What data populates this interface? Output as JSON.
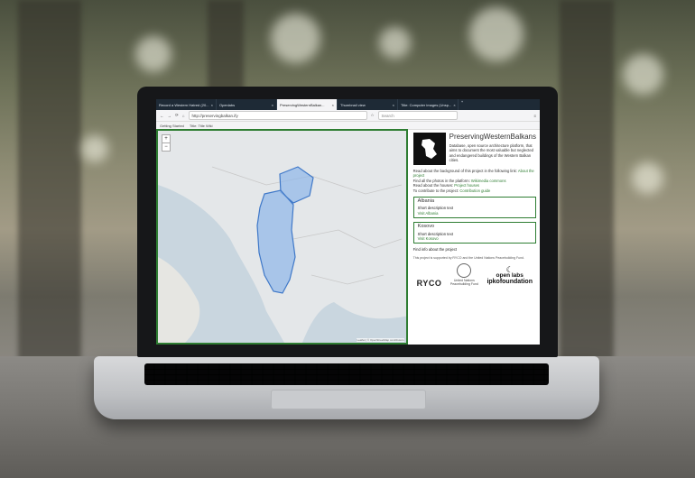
{
  "browser": {
    "tabs": [
      {
        "label": "Record a Western Hatred (20..."
      },
      {
        "label": "Openlabs"
      },
      {
        "label": "PreservingWesternBalkan..."
      },
      {
        "label": "Thumbnail view"
      },
      {
        "label": "Title: Computer images (Unsp..."
      }
    ],
    "url": "http://preservingbalkan.ify",
    "search_placeholder": "Search",
    "bookmarks": [
      "Getting Started",
      "Title: Title Wiki"
    ]
  },
  "map": {
    "zoom_in": "+",
    "zoom_out": "−",
    "attribution": "Leaflet | © OpenStreetMap contributors"
  },
  "panel": {
    "title": "PreservingWesternBalkans",
    "intro": "Database, open source architecture platform, that aims to document the most valuable but neglected and endangered buildings of the Western Balkan cities.",
    "bg_line": "Read about the background of this project in the following link:",
    "bg_link": "About the project",
    "find_line": "Find all the photos in the platform:",
    "find_link": "Wikimedia commons",
    "read_line": "Read about the houses:",
    "read_link": "Project houses",
    "contrib_line": "To contribute to the project:",
    "contrib_link": "Contribution guide",
    "cards": [
      {
        "name": "Albania",
        "desc": "Short description text",
        "visit": "Visit Albania"
      },
      {
        "name": "Kosovo",
        "desc": "Short description text",
        "visit": "Visit Kosovo"
      }
    ],
    "footer_line": "Find info about the project",
    "small_text": "This project is supported by RYCO and the United Nations Peacebuilding Fund.",
    "logos": {
      "ryco": "RYCO",
      "un_line1": "United Nations",
      "un_line2": "Peacebuilding Fund",
      "open_labs": "open labs",
      "ipko": "ipkofoundation"
    }
  },
  "colors": {
    "accent_green": "#2e7d32",
    "region_blue": "#8fb6e8"
  }
}
